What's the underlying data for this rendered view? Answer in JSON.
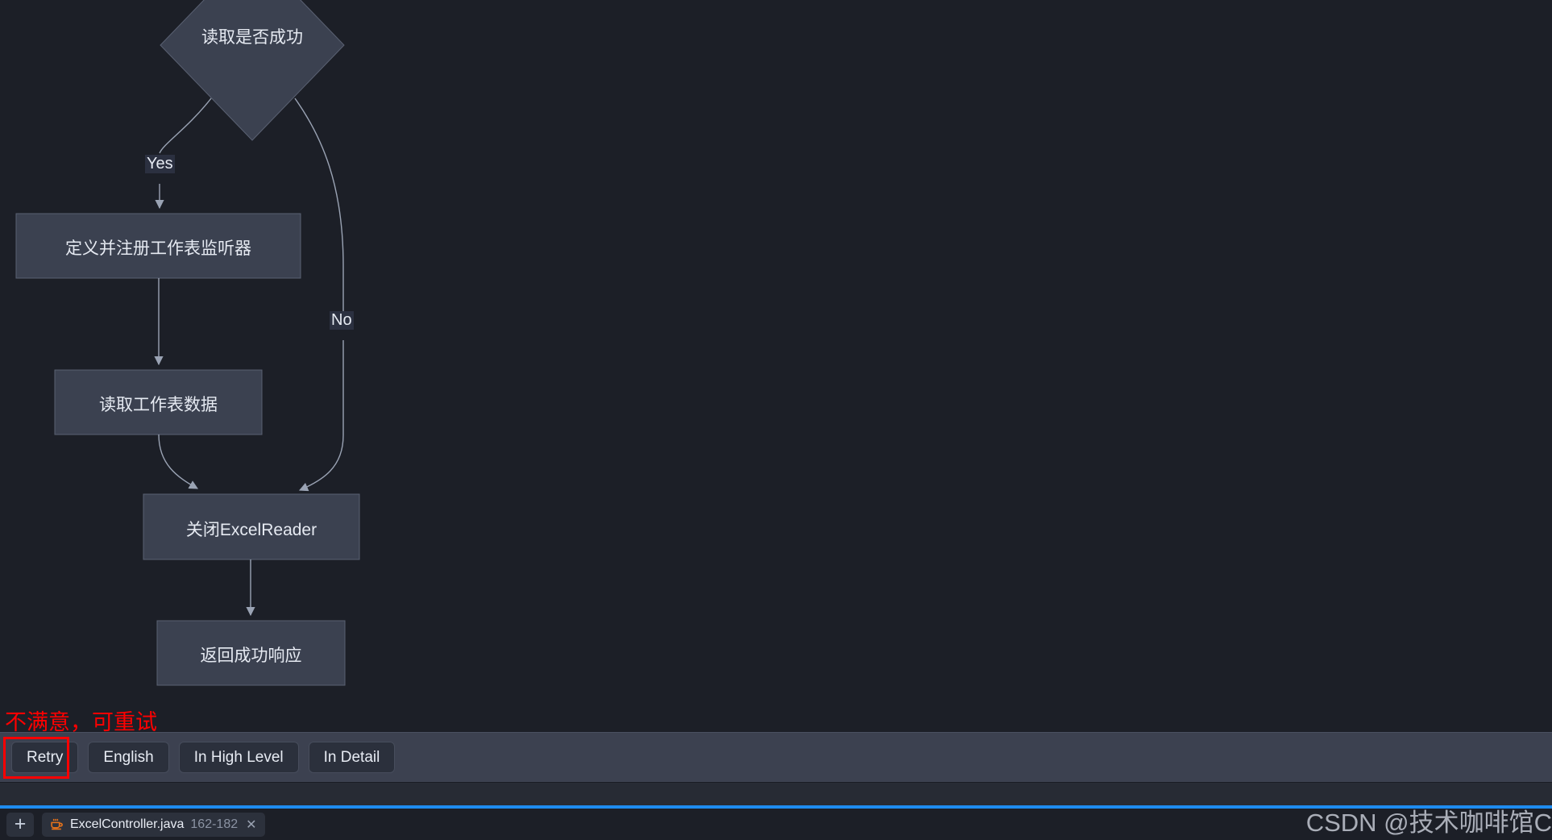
{
  "diagram": {
    "type": "flowchart",
    "nodes": [
      {
        "id": "decision",
        "shape": "diamond",
        "label": "读取是否成功"
      },
      {
        "id": "register",
        "shape": "rect",
        "label": "定义并注册工作表监听器"
      },
      {
        "id": "readsheet",
        "shape": "rect",
        "label": "读取工作表数据"
      },
      {
        "id": "closereader",
        "shape": "rect",
        "label": "关闭ExcelReader"
      },
      {
        "id": "success",
        "shape": "rect",
        "label": "返回成功响应"
      }
    ],
    "edges": [
      {
        "from": "decision",
        "to": "register",
        "label": "Yes"
      },
      {
        "from": "decision",
        "to": "closereader",
        "label": "No"
      },
      {
        "from": "register",
        "to": "readsheet",
        "label": ""
      },
      {
        "from": "readsheet",
        "to": "closereader",
        "label": ""
      },
      {
        "from": "closereader",
        "to": "success",
        "label": ""
      }
    ],
    "colors": {
      "node_fill": "#3b4150",
      "node_stroke": "#5a6172",
      "edge_stroke": "#9aa3b4",
      "label_text": "#e6eaf2",
      "canvas_bg": "#1c1f27"
    }
  },
  "action_bar": {
    "buttons": [
      {
        "id": "retry",
        "label": "Retry"
      },
      {
        "id": "english",
        "label": "English"
      },
      {
        "id": "high-level",
        "label": "In High Level"
      },
      {
        "id": "detail",
        "label": "In Detail"
      }
    ]
  },
  "tab_bar": {
    "new_tab_icon": "plus-icon",
    "tabs": [
      {
        "icon": "java-file-icon",
        "filename": "ExcelController.java",
        "line_range": "162-182",
        "close_icon": "close-icon"
      }
    ]
  },
  "annotations": {
    "note_text": "不满意，可重试",
    "note_color": "#ff0000",
    "highlight_target": "retry"
  },
  "watermark": {
    "text": "CSDN @技术咖啡馆C",
    "color": "#c3c8d2"
  }
}
